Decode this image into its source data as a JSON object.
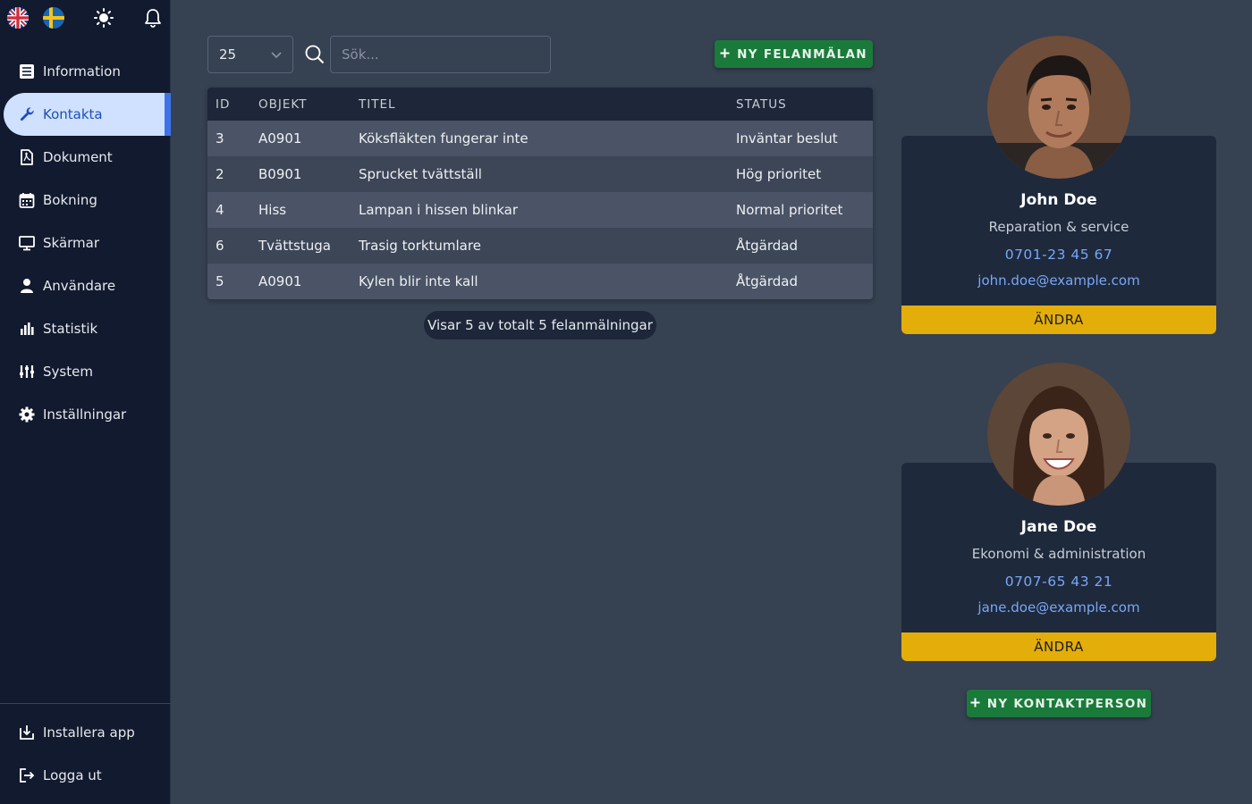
{
  "sidebar": {
    "top_icons": [
      "uk-flag-icon",
      "swedish-flag-icon",
      "sun-icon",
      "bell-icon"
    ],
    "items": [
      {
        "label": "Information",
        "icon": "list-icon",
        "active": false
      },
      {
        "label": "Kontakta",
        "icon": "wrench-icon",
        "active": true
      },
      {
        "label": "Dokument",
        "icon": "pdf-icon",
        "active": false
      },
      {
        "label": "Bokning",
        "icon": "calendar-icon",
        "active": false
      },
      {
        "label": "Skärmar",
        "icon": "monitor-icon",
        "active": false
      },
      {
        "label": "Användare",
        "icon": "user-icon",
        "active": false
      },
      {
        "label": "Statistik",
        "icon": "bar-chart-icon",
        "active": false
      },
      {
        "label": "System",
        "icon": "sliders-icon",
        "active": false
      },
      {
        "label": "Inställningar",
        "icon": "gear-icon",
        "active": false
      }
    ],
    "bottom_items": [
      {
        "label": "Installera app",
        "icon": "install-icon"
      },
      {
        "label": "Logga ut",
        "icon": "logout-icon"
      }
    ]
  },
  "toolbar": {
    "page_size": "25",
    "search_placeholder": "Sök...",
    "new_report_label": "NY FELANMÄLAN"
  },
  "table": {
    "headers": [
      "ID",
      "OBJEKT",
      "TITEL",
      "STATUS"
    ],
    "rows": [
      [
        "3",
        "A0901",
        "Köksfläkten fungerar inte",
        "Inväntar beslut"
      ],
      [
        "2",
        "B0901",
        "Sprucket tvättställ",
        "Hög prioritet"
      ],
      [
        "4",
        "Hiss",
        "Lampan i hissen blinkar",
        "Normal prioritet"
      ],
      [
        "6",
        "Tvättstuga",
        "Trasig torktumlare",
        "Åtgärdad"
      ],
      [
        "5",
        "A0901",
        "Kylen blir inte kall",
        "Åtgärdad"
      ]
    ],
    "footer": "Visar 5 av totalt 5 felanmälningar"
  },
  "contacts": [
    {
      "name": "John Doe",
      "role": "Reparation & service",
      "phone": "0701-23 45 67",
      "email": "john.doe@example.com",
      "button": "ÄNDRA"
    },
    {
      "name": "Jane Doe",
      "role": "Ekonomi & administration",
      "phone": "0707-65 43 21",
      "email": "jane.doe@example.com",
      "button": "ÄNDRA"
    }
  ],
  "new_contact_label": "NY KONTAKTPERSON",
  "colors": {
    "background": "#364152",
    "sidebar": "#111a2e",
    "active_item": "#cfe1ff",
    "accent_blue": "#3d73e8",
    "green_button": "#1a7a3a",
    "yellow_button": "#e3ad0a",
    "link": "#7aa7f5"
  }
}
